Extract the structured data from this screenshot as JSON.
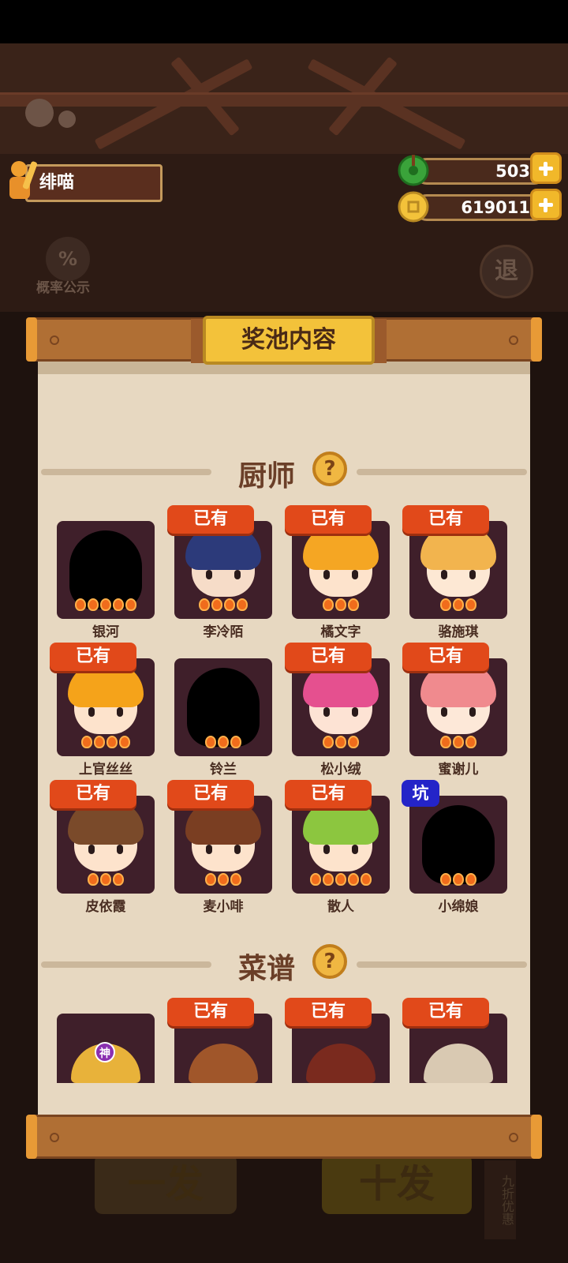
{
  "player": {
    "name": "绯喵"
  },
  "currency": {
    "jade": "503",
    "coins": "619011"
  },
  "background": {
    "probability_label": "概率公示",
    "probability_icon": "%",
    "exit_label": "退",
    "draw_one_label": "一发",
    "draw_ten_label": "十发",
    "discount_tag": "九折优惠"
  },
  "pool": {
    "title": "奖池内容",
    "chef_section_title": "厨师",
    "recipe_section_title": "菜谱",
    "help_glyph": "?",
    "owned_label": "已有",
    "pit_label": "坑",
    "god_label": "神"
  },
  "chefs": [
    {
      "name": "银河",
      "owned": false,
      "pit": false,
      "locked": true,
      "stars": 5,
      "hair": "#000000",
      "face": "#000000"
    },
    {
      "name": "李冷陌",
      "owned": true,
      "pit": false,
      "locked": false,
      "stars": 4,
      "hair": "#2c3a7a",
      "face": "#f6dcc8"
    },
    {
      "name": "橘文字",
      "owned": true,
      "pit": false,
      "locked": false,
      "stars": 3,
      "hair": "#f5a623",
      "face": "#fde3cc"
    },
    {
      "name": "骆施琪",
      "owned": true,
      "pit": false,
      "locked": false,
      "stars": 3,
      "hair": "#f2b44e",
      "face": "#fde8d4"
    },
    {
      "name": "上官丝丝",
      "owned": true,
      "pit": false,
      "locked": false,
      "stars": 4,
      "hair": "#f5a31a",
      "face": "#fde3cc"
    },
    {
      "name": "铃兰",
      "owned": false,
      "pit": false,
      "locked": true,
      "stars": 3,
      "hair": "#000000",
      "face": "#000000"
    },
    {
      "name": "松小绒",
      "owned": true,
      "pit": false,
      "locked": false,
      "stars": 3,
      "hair": "#e5508f",
      "face": "#fde3d4"
    },
    {
      "name": "蜜谢儿",
      "owned": true,
      "pit": false,
      "locked": false,
      "stars": 3,
      "hair": "#f08a8e",
      "face": "#fde8d8"
    },
    {
      "name": "皮依霞",
      "owned": true,
      "pit": false,
      "locked": false,
      "stars": 3,
      "hair": "#7a4a2a",
      "face": "#fde3cc"
    },
    {
      "name": "麦小啡",
      "owned": true,
      "pit": false,
      "locked": false,
      "stars": 3,
      "hair": "#7a3e22",
      "face": "#fde3cc"
    },
    {
      "name": "散人",
      "owned": true,
      "pit": false,
      "locked": false,
      "stars": 5,
      "hair": "#8cc63f",
      "face": "#fde3cc"
    },
    {
      "name": "小绵娘",
      "owned": false,
      "pit": true,
      "locked": true,
      "stars": 3,
      "hair": "#000000",
      "face": "#000000"
    }
  ],
  "recipes": [
    {
      "owned": false,
      "god": true,
      "color": "#e8b23a"
    },
    {
      "owned": true,
      "god": false,
      "color": "#a0562a"
    },
    {
      "owned": true,
      "god": false,
      "color": "#7a2a1e"
    },
    {
      "owned": true,
      "god": false,
      "color": "#d9c9b2"
    }
  ],
  "colors": {
    "owned_badge": "#e1491a",
    "pit_badge": "#2424c8",
    "gold": "#f3c23a",
    "card_bg": "#3f1f2a"
  }
}
